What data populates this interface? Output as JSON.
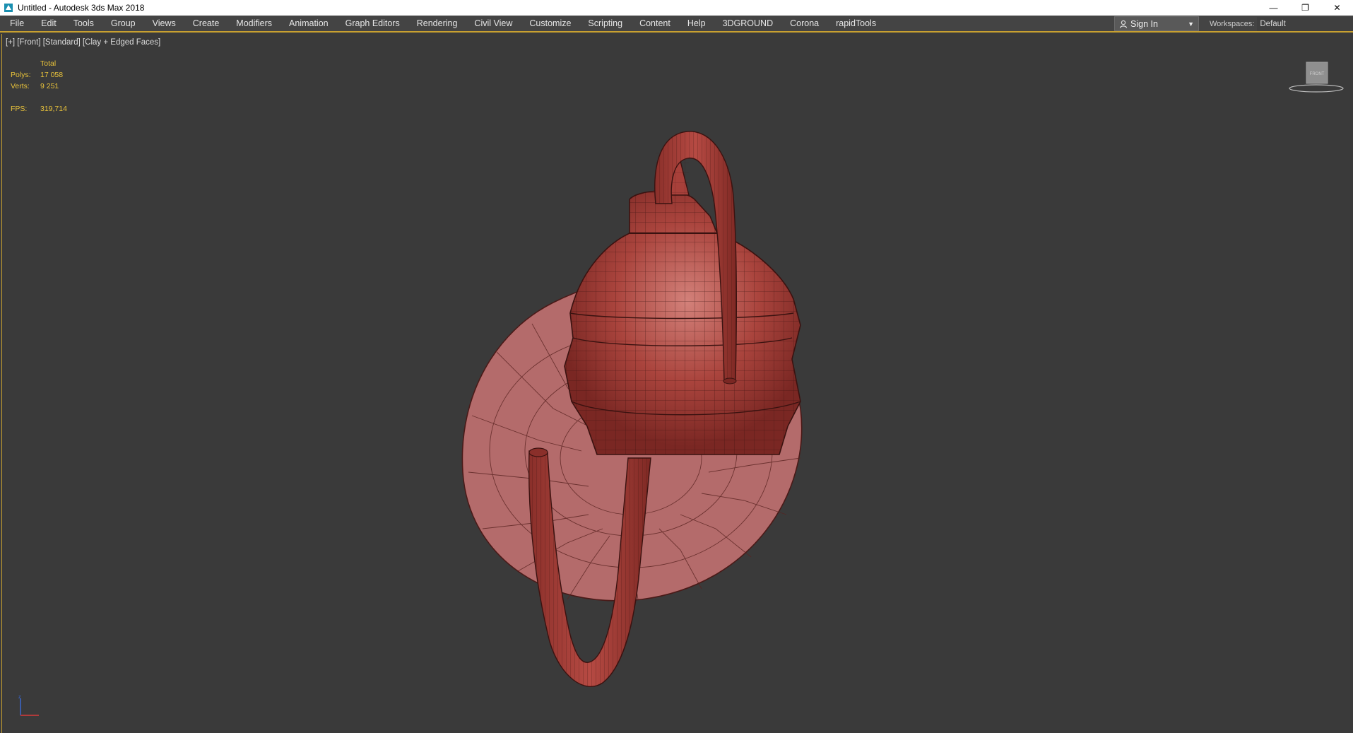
{
  "window": {
    "title": "Untitled - Autodesk 3ds Max 2018",
    "controls": [
      "—",
      "❐",
      "✕"
    ]
  },
  "menu": {
    "items": [
      "File",
      "Edit",
      "Tools",
      "Group",
      "Views",
      "Create",
      "Modifiers",
      "Animation",
      "Graph Editors",
      "Rendering",
      "Civil View",
      "Customize",
      "Scripting",
      "Content",
      "Help",
      "3DGROUND",
      "Corona",
      "rapidTools"
    ]
  },
  "account": {
    "signin_label": "Sign In",
    "workspaces_label": "Workspaces:",
    "workspace_value": "Default"
  },
  "viewport": {
    "label": "[+] [Front] [Standard] [Clay + Edged Faces]",
    "stats": {
      "total_label": "Total",
      "polys_label": "Polys:",
      "polys_value": "17 058",
      "verts_label": "Verts:",
      "verts_value": "9 251",
      "fps_label": "FPS:",
      "fps_value": "319,714"
    },
    "viewcube_label": "FRONT"
  },
  "colors": {
    "model_main": "#a8403a",
    "model_plate": "#b87070",
    "stats_text": "#e8c23a",
    "accent_border": "#c8a030"
  }
}
